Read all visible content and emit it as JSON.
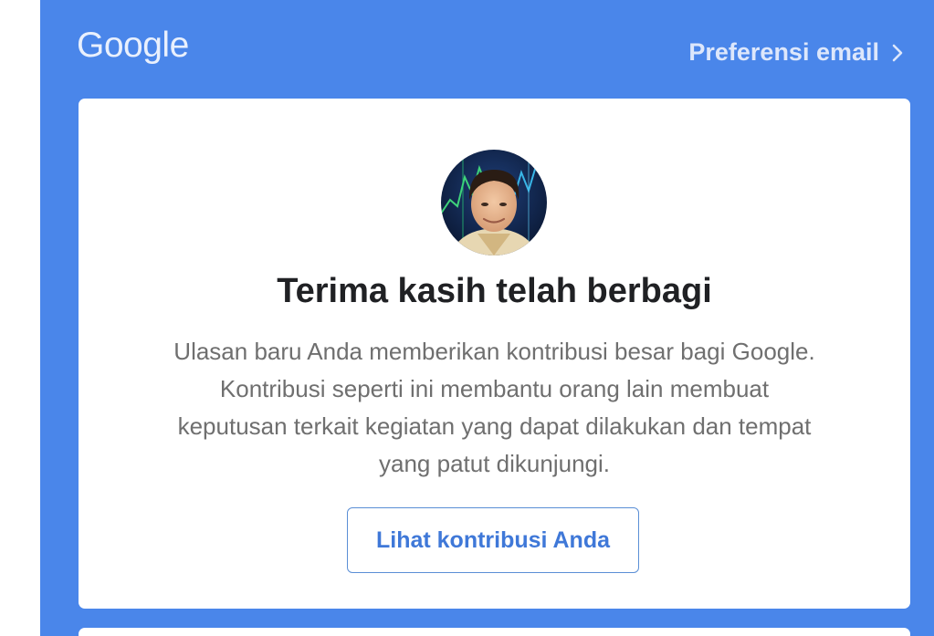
{
  "header": {
    "logo_text": "Google",
    "preferences_label": "Preferensi email"
  },
  "card": {
    "avatar": "profile-photo",
    "title": "Terima kasih telah berbagi",
    "body": "Ulasan baru Anda memberikan kontribusi besar bagi Google. Kontribusi seperti ini membantu orang lain membuat keputusan terkait kegiatan yang dapat dilakukan dan tempat yang patut dikunjungi.",
    "button_label": "Lihat kontribusi Anda"
  },
  "colors": {
    "header_blue": "#4a86ea",
    "card_white": "#ffffff",
    "title_text": "#202124",
    "body_text": "#6f6f6f",
    "button_text": "#3f78d8"
  },
  "icons": {
    "preferences_chevron": "chevron-right-icon"
  }
}
